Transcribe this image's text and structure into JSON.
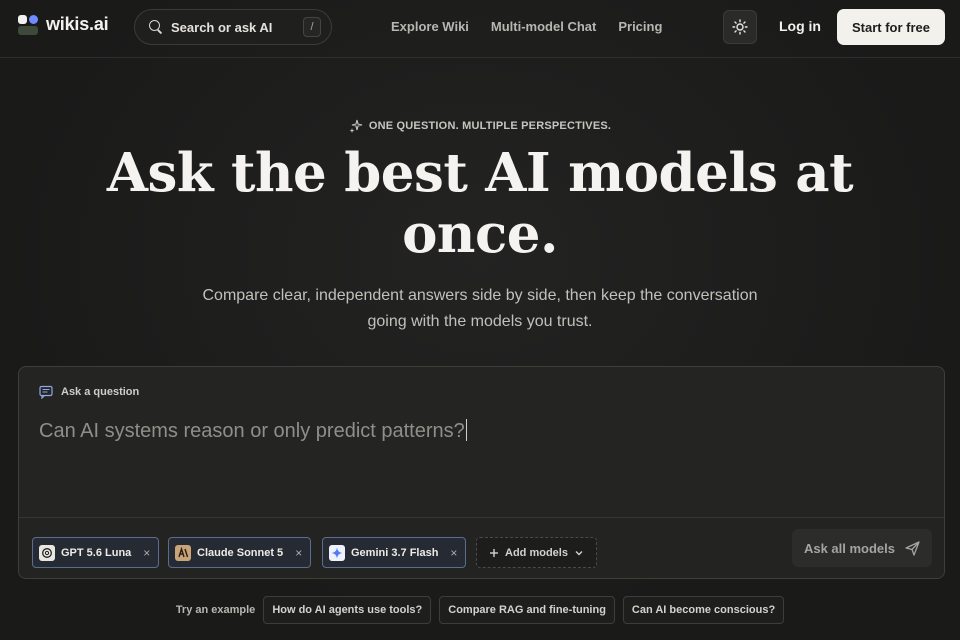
{
  "header": {
    "logo_text": "wikis.ai",
    "search_label": "Search or ask AI",
    "search_shortcut": "/",
    "nav": [
      "Explore Wiki",
      "Multi-model Chat",
      "Pricing"
    ],
    "login_label": "Log in",
    "start_label": "Start for free"
  },
  "hero": {
    "eyebrow": "ONE QUESTION. MULTIPLE PERSPECTIVES.",
    "title_line1": "Ask the best AI models at",
    "title_line2": "once.",
    "subtitle_line1": "Compare clear, independent answers side by side, then keep the conversation",
    "subtitle_line2": "going with the models you trust."
  },
  "question_card": {
    "label": "Ask a question",
    "placeholder": "Can AI systems reason or only predict patterns?",
    "models": [
      {
        "name": "GPT 5.6 Luna",
        "icon": "openai-icon"
      },
      {
        "name": "Claude Sonnet 5",
        "icon": "anthropic-icon"
      },
      {
        "name": "Gemini 3.7 Flash",
        "icon": "gemini-icon"
      }
    ],
    "remove_glyph": "×",
    "add_models_label": "Add models",
    "ask_all_label": "Ask all models"
  },
  "examples": {
    "label": "Try an example",
    "items": [
      "How do AI agents use tools?",
      "Compare RAG and fine-tuning",
      "Can AI become conscious?"
    ]
  },
  "colors": {
    "background": "#1c1c1b",
    "primary_button": "#f3f1ec",
    "chip_border": "#5a6c90"
  }
}
